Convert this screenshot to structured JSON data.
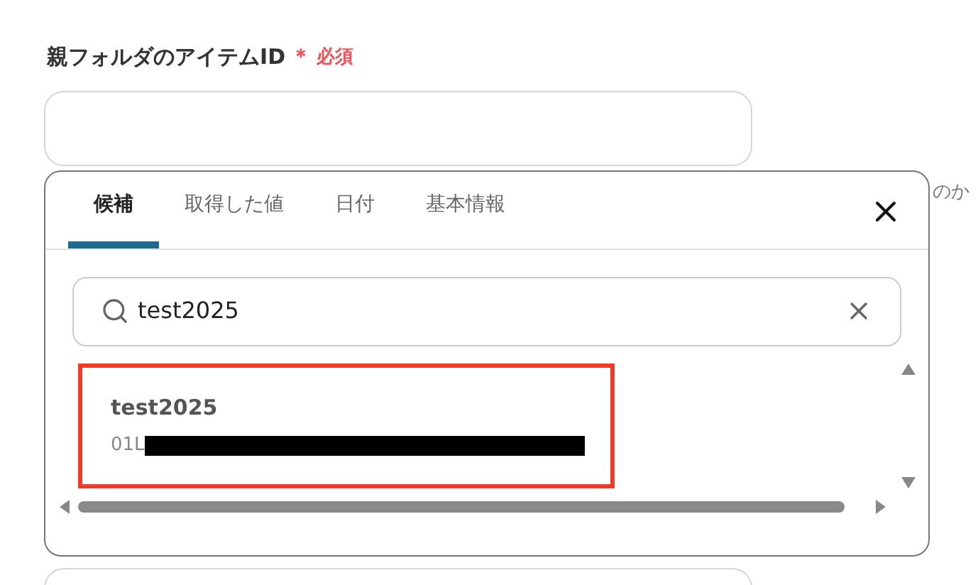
{
  "field": {
    "label": "親フォルダのアイテムID",
    "required_mark": "＊",
    "required_text": "必須"
  },
  "side_text": "のか",
  "popup": {
    "tabs": [
      {
        "label": "候補",
        "selected": true
      },
      {
        "label": "取得した値",
        "selected": false
      },
      {
        "label": "日付",
        "selected": false
      },
      {
        "label": "基本情報",
        "selected": false
      }
    ],
    "search": {
      "value": "test2025"
    },
    "results": [
      {
        "title": "test2025",
        "id_prefix": "01L",
        "redacted": true,
        "highlighted": true
      }
    ]
  }
}
